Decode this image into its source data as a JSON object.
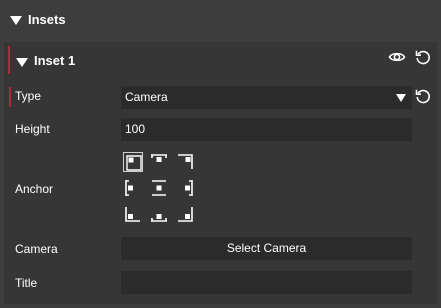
{
  "section": {
    "title": "Insets"
  },
  "inset": {
    "title": "Inset 1"
  },
  "fields": {
    "type": {
      "label": "Type",
      "value": "Camera"
    },
    "height": {
      "label": "Height",
      "value": "100"
    },
    "anchor": {
      "label": "Anchor",
      "selected": "top-left"
    },
    "camera": {
      "label": "Camera",
      "button": "Select Camera"
    },
    "title": {
      "label": "Title",
      "value": ""
    }
  },
  "colors": {
    "accent": "#b8263a",
    "background": "#3d3d3d",
    "field": "#2b2b2b"
  }
}
